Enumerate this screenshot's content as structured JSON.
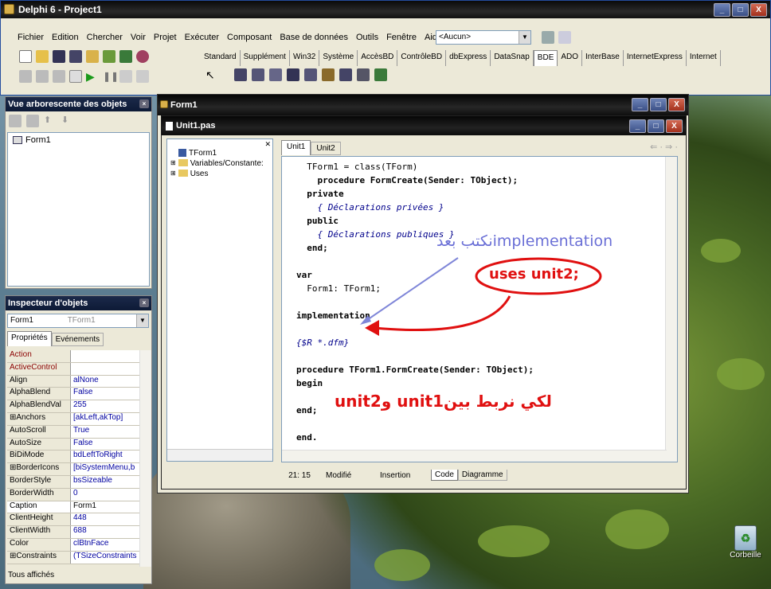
{
  "ide": {
    "title": "Delphi 6 - Project1",
    "menu": [
      "Fichier",
      "Edition",
      "Chercher",
      "Voir",
      "Projet",
      "Exécuter",
      "Composant",
      "Base de données",
      "Outils",
      "Fenêtre",
      "Aide"
    ],
    "combo_value": "<Aucun>",
    "palette_tabs": [
      "Standard",
      "Supplément",
      "Win32",
      "Système",
      "AccèsBD",
      "ContrôleBD",
      "dbExpress",
      "DataSnap",
      "BDE",
      "ADO",
      "InterBase",
      "InternetExpress",
      "Internet"
    ],
    "active_palette_tab": "BDE"
  },
  "object_tree": {
    "title": "Vue arborescente des objets",
    "items": [
      "Form1"
    ]
  },
  "inspector": {
    "title": "Inspecteur d'objets",
    "selected_object": "Form1",
    "selected_type": "TForm1",
    "tabs": [
      "Propriétés",
      "Evénements"
    ],
    "rows": [
      {
        "name": "Action",
        "value": "",
        "red": true
      },
      {
        "name": "ActiveControl",
        "value": "",
        "red": true
      },
      {
        "name": "Align",
        "value": "alNone"
      },
      {
        "name": "AlphaBlend",
        "value": "False"
      },
      {
        "name": "AlphaBlendVal",
        "value": "255"
      },
      {
        "name": "⊞Anchors",
        "value": "[akLeft,akTop]"
      },
      {
        "name": "AutoScroll",
        "value": "True"
      },
      {
        "name": "AutoSize",
        "value": "False"
      },
      {
        "name": "BiDiMode",
        "value": "bdLeftToRight"
      },
      {
        "name": "⊞BorderIcons",
        "value": "[biSystemMenu,b"
      },
      {
        "name": "BorderStyle",
        "value": "bsSizeable"
      },
      {
        "name": "BorderWidth",
        "value": "0"
      },
      {
        "name": "Caption",
        "value": "Form1",
        "sel": true
      },
      {
        "name": "ClientHeight",
        "value": "448"
      },
      {
        "name": "ClientWidth",
        "value": "688"
      },
      {
        "name": "Color",
        "value": "clBtnFace"
      },
      {
        "name": "⊞Constraints",
        "value": "(TSizeConstraints"
      }
    ],
    "footer": "Tous affichés"
  },
  "form_window": {
    "title": "Form1"
  },
  "unit_window": {
    "title": "Unit1.pas",
    "tree_items": [
      "TForm1",
      "Variables/Constante:",
      "Uses"
    ],
    "tabs": [
      "Unit1",
      "Unit2"
    ],
    "code_lines": [
      "  TForm1 = class(TForm)",
      "    procedure FormCreate(Sender: TObject);",
      "  private",
      "    { Déclarations privées }",
      "  public",
      "    { Déclarations publiques }",
      "  end;",
      "",
      "var",
      "  Form1: TForm1;",
      "",
      "implementation",
      "",
      "{$R *.dfm}",
      "",
      "procedure TForm1.FormCreate(Sender: TObject);",
      "begin",
      "",
      "end;",
      "",
      "end."
    ],
    "status_pos": "21: 15",
    "status_modified": "Modifié",
    "status_mode": "Insertion",
    "bottom_tabs": [
      "Code",
      "Diagramme"
    ]
  },
  "annotations": {
    "arrow_note": "نكتب بعدimplementation",
    "uses_note": "uses unit2;",
    "link_note": "لكي نربط بينunit1 وunit2"
  },
  "desktop": {
    "recycle_bin": "Corbeille"
  }
}
